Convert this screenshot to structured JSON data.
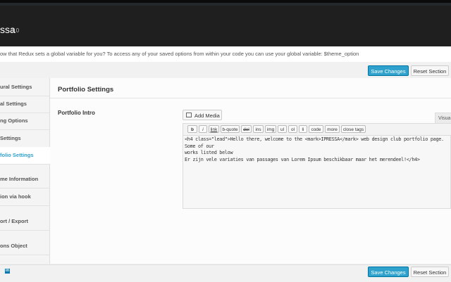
{
  "header": {
    "title": "ssa",
    "version": "1.0"
  },
  "notice": {
    "text": "ow that Redux sets a global variable for you? To access any of your saved options from within your code you can use your global variable: $theme_option"
  },
  "actions": {
    "save_label": "Save Changes",
    "reset_label": "Reset Section"
  },
  "sidebar": {
    "items": [
      {
        "label": "ural Settings"
      },
      {
        "label": "al Settings"
      },
      {
        "label": "ng Options"
      },
      {
        "label": "Settings"
      },
      {
        "label": "folio Settings",
        "active": true
      },
      {
        "label": "me Information"
      },
      {
        "label": "ion via hook"
      },
      {
        "label": "ort / Export"
      },
      {
        "label": "ons Object"
      }
    ]
  },
  "section": {
    "title": "Portfolio Settings",
    "field_label": "Portfolio Intro"
  },
  "editor": {
    "add_media_label": "Add Media",
    "visual_tab": "Visua",
    "buttons": [
      "b",
      "i",
      "link",
      "b-quote",
      "del",
      "ins",
      "img",
      "ul",
      "ol",
      "li",
      "code",
      "more",
      "close tags"
    ],
    "lines": [
      "<h4 class=\"lead\">Hello there, welcome to the <mark>IPRESSA</mark> web design club portfolio page. Some of our",
      "works listed below",
      "Er zijn vele variaties van passages van Lorem Ipsum beschikbaar maar het merendeel!</h4>"
    ]
  },
  "footer": {
    "save_label": "Save Changes",
    "reset_label": "Reset Section",
    "social_icon": "in"
  }
}
